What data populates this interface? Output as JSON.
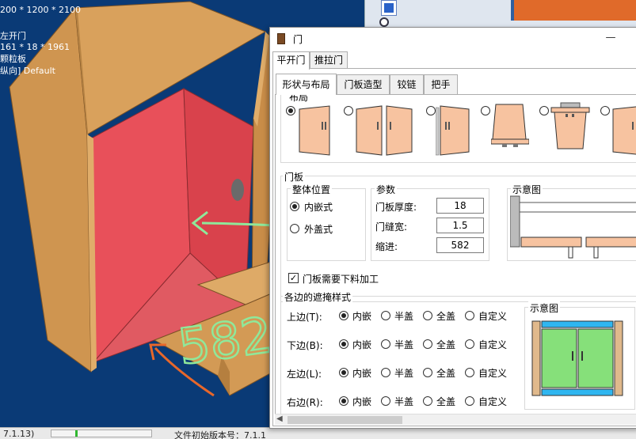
{
  "viewport": {
    "info_lines": [
      "200 * 1200 * 2100",
      "左开门",
      "161 * 18 * 1961",
      "颗粒板",
      "纵向] Default"
    ],
    "annotation_number": "582"
  },
  "statusbar": {
    "version_left": "7.1.13)",
    "version_right": "文件初始版本号：7.1.1"
  },
  "dialog": {
    "title": "门",
    "minimize_label": "—",
    "outer_tabs": [
      "平开门",
      "推拉门"
    ],
    "inner_tabs": [
      "形状与布局",
      "门板造型",
      "铰链",
      "把手"
    ],
    "layout_group": {
      "title": "布局"
    },
    "door_panel_group": {
      "title": "门板"
    },
    "overall_position": {
      "title": "整体位置",
      "options": [
        "内嵌式",
        "外盖式"
      ],
      "selected": 0
    },
    "params": {
      "title": "参数",
      "rows": [
        {
          "label": "门板厚度:",
          "value": "18"
        },
        {
          "label": "门缝宽:",
          "value": "1.5"
        },
        {
          "label": "缩进:",
          "value": "582"
        }
      ]
    },
    "diagram_top": {
      "title": "示意图"
    },
    "needs_cutting": {
      "label": "门板需要下料加工",
      "checked": true
    },
    "edge_group": {
      "title": "各边的遮掩样式",
      "rows": [
        {
          "label": "上边(T):"
        },
        {
          "label": "下边(B):"
        },
        {
          "label": "左边(L):"
        },
        {
          "label": "右边(R):"
        }
      ],
      "options": [
        "内嵌",
        "半盖",
        "全盖",
        "自定义"
      ],
      "selected": 0
    },
    "diagram_bottom": {
      "title": "示意图"
    }
  }
}
